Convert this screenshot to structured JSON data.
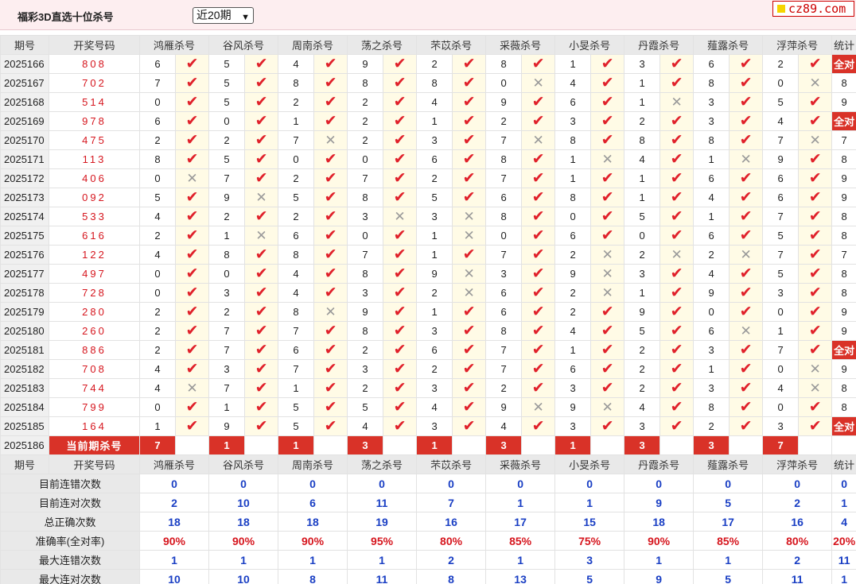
{
  "app": {
    "title": "福彩3D直选十位杀号",
    "period_select": "近20期",
    "logo_text": "cz89.com"
  },
  "headers": {
    "period": "期号",
    "draw": "开奖号码",
    "experts": [
      "鸿雁杀号",
      "谷风杀号",
      "周南杀号",
      "荡之杀号",
      "芣苡杀号",
      "采薇杀号",
      "小旻杀号",
      "丹霞杀号",
      "薤露杀号",
      "浮萍杀号"
    ],
    "stat": "统计"
  },
  "rows": [
    {
      "period": "2025166",
      "draw": "808",
      "kills": [
        6,
        5,
        4,
        9,
        2,
        8,
        1,
        3,
        6,
        2
      ],
      "hits": [
        1,
        1,
        1,
        1,
        1,
        1,
        1,
        1,
        1,
        1
      ],
      "stat": "全对"
    },
    {
      "period": "2025167",
      "draw": "702",
      "kills": [
        7,
        5,
        8,
        8,
        8,
        0,
        4,
        1,
        8,
        0
      ],
      "hits": [
        1,
        1,
        1,
        1,
        1,
        0,
        1,
        1,
        1,
        0
      ],
      "stat": "8"
    },
    {
      "period": "2025168",
      "draw": "514",
      "kills": [
        0,
        5,
        2,
        2,
        4,
        9,
        6,
        1,
        3,
        5
      ],
      "hits": [
        1,
        1,
        1,
        1,
        1,
        1,
        1,
        0,
        1,
        1
      ],
      "stat": "9"
    },
    {
      "period": "2025169",
      "draw": "978",
      "kills": [
        6,
        0,
        1,
        2,
        1,
        2,
        3,
        2,
        3,
        4
      ],
      "hits": [
        1,
        1,
        1,
        1,
        1,
        1,
        1,
        1,
        1,
        1
      ],
      "stat": "全对"
    },
    {
      "period": "2025170",
      "draw": "475",
      "kills": [
        2,
        2,
        7,
        2,
        3,
        7,
        8,
        8,
        8,
        7
      ],
      "hits": [
        1,
        1,
        0,
        1,
        1,
        0,
        1,
        1,
        1,
        0
      ],
      "stat": "7"
    },
    {
      "period": "2025171",
      "draw": "113",
      "kills": [
        8,
        5,
        0,
        0,
        6,
        8,
        1,
        4,
        1,
        9
      ],
      "hits": [
        1,
        1,
        1,
        1,
        1,
        1,
        0,
        1,
        0,
        1
      ],
      "stat": "8"
    },
    {
      "period": "2025172",
      "draw": "406",
      "kills": [
        0,
        7,
        2,
        7,
        2,
        7,
        1,
        1,
        6,
        6
      ],
      "hits": [
        0,
        1,
        1,
        1,
        1,
        1,
        1,
        1,
        1,
        1
      ],
      "stat": "9"
    },
    {
      "period": "2025173",
      "draw": "092",
      "kills": [
        5,
        9,
        5,
        8,
        5,
        6,
        8,
        1,
        4,
        6
      ],
      "hits": [
        1,
        0,
        1,
        1,
        1,
        1,
        1,
        1,
        1,
        1
      ],
      "stat": "9"
    },
    {
      "period": "2025174",
      "draw": "533",
      "kills": [
        4,
        2,
        2,
        3,
        3,
        8,
        0,
        5,
        1,
        7
      ],
      "hits": [
        1,
        1,
        1,
        0,
        0,
        1,
        1,
        1,
        1,
        1
      ],
      "stat": "8"
    },
    {
      "period": "2025175",
      "draw": "616",
      "kills": [
        2,
        1,
        6,
        0,
        1,
        0,
        6,
        0,
        6,
        5
      ],
      "hits": [
        1,
        0,
        1,
        1,
        0,
        1,
        1,
        1,
        1,
        1
      ],
      "stat": "8"
    },
    {
      "period": "2025176",
      "draw": "122",
      "kills": [
        4,
        8,
        8,
        7,
        1,
        7,
        2,
        2,
        2,
        7
      ],
      "hits": [
        1,
        1,
        1,
        1,
        1,
        1,
        0,
        0,
        0,
        1
      ],
      "stat": "7"
    },
    {
      "period": "2025177",
      "draw": "497",
      "kills": [
        0,
        0,
        4,
        8,
        9,
        3,
        9,
        3,
        4,
        5
      ],
      "hits": [
        1,
        1,
        1,
        1,
        0,
        1,
        0,
        1,
        1,
        1
      ],
      "stat": "8"
    },
    {
      "period": "2025178",
      "draw": "728",
      "kills": [
        0,
        3,
        4,
        3,
        2,
        6,
        2,
        1,
        9,
        3
      ],
      "hits": [
        1,
        1,
        1,
        1,
        0,
        1,
        0,
        1,
        1,
        1
      ],
      "stat": "8"
    },
    {
      "period": "2025179",
      "draw": "280",
      "kills": [
        2,
        2,
        8,
        9,
        1,
        6,
        2,
        9,
        0,
        0
      ],
      "hits": [
        1,
        1,
        0,
        1,
        1,
        1,
        1,
        1,
        1,
        1
      ],
      "stat": "9"
    },
    {
      "period": "2025180",
      "draw": "260",
      "kills": [
        2,
        7,
        7,
        8,
        3,
        8,
        4,
        5,
        6,
        1
      ],
      "hits": [
        1,
        1,
        1,
        1,
        1,
        1,
        1,
        1,
        0,
        1
      ],
      "stat": "9"
    },
    {
      "period": "2025181",
      "draw": "886",
      "kills": [
        2,
        7,
        6,
        2,
        6,
        7,
        1,
        2,
        3,
        7
      ],
      "hits": [
        1,
        1,
        1,
        1,
        1,
        1,
        1,
        1,
        1,
        1
      ],
      "stat": "全对"
    },
    {
      "period": "2025182",
      "draw": "708",
      "kills": [
        4,
        3,
        7,
        3,
        2,
        7,
        6,
        2,
        1,
        0
      ],
      "hits": [
        1,
        1,
        1,
        1,
        1,
        1,
        1,
        1,
        1,
        0
      ],
      "stat": "9"
    },
    {
      "period": "2025183",
      "draw": "744",
      "kills": [
        4,
        7,
        1,
        2,
        3,
        2,
        3,
        2,
        3,
        4
      ],
      "hits": [
        0,
        1,
        1,
        1,
        1,
        1,
        1,
        1,
        1,
        0
      ],
      "stat": "8"
    },
    {
      "period": "2025184",
      "draw": "799",
      "kills": [
        0,
        1,
        5,
        5,
        4,
        9,
        9,
        4,
        8,
        0
      ],
      "hits": [
        1,
        1,
        1,
        1,
        1,
        0,
        0,
        1,
        1,
        1
      ],
      "stat": "8"
    },
    {
      "period": "2025185",
      "draw": "164",
      "kills": [
        1,
        9,
        5,
        4,
        3,
        4,
        3,
        3,
        2,
        3
      ],
      "hits": [
        1,
        1,
        1,
        1,
        1,
        1,
        1,
        1,
        1,
        1
      ],
      "stat": "全对"
    }
  ],
  "current": {
    "period": "2025186",
    "label": "当前期杀号",
    "kills": [
      7,
      1,
      1,
      3,
      1,
      3,
      1,
      3,
      3,
      7
    ]
  },
  "summary": [
    {
      "label": "目前连错次数",
      "values": [
        "0",
        "0",
        "0",
        "0",
        "0",
        "0",
        "0",
        "0",
        "0",
        "0"
      ],
      "stat": "0"
    },
    {
      "label": "目前连对次数",
      "values": [
        "2",
        "10",
        "6",
        "11",
        "7",
        "1",
        "1",
        "9",
        "5",
        "2"
      ],
      "stat": "1"
    },
    {
      "label": "总正确次数",
      "values": [
        "18",
        "18",
        "18",
        "19",
        "16",
        "17",
        "15",
        "18",
        "17",
        "16"
      ],
      "stat": "4"
    },
    {
      "label": "准确率(全对率)",
      "values": [
        "90%",
        "90%",
        "90%",
        "95%",
        "80%",
        "85%",
        "75%",
        "90%",
        "85%",
        "80%"
      ],
      "stat": "20%",
      "is_rate": true
    },
    {
      "label": "最大连错次数",
      "values": [
        "1",
        "1",
        "1",
        "1",
        "2",
        "1",
        "3",
        "1",
        "1",
        "2"
      ],
      "stat": "11"
    },
    {
      "label": "最大连对次数",
      "values": [
        "10",
        "10",
        "8",
        "11",
        "8",
        "13",
        "5",
        "9",
        "5",
        "11"
      ],
      "stat": "1"
    }
  ],
  "icons": {
    "hit": "check-icon",
    "miss": "cross-icon"
  },
  "colors": {
    "accent": "#d93228",
    "number": "#d6161e",
    "summary_value": "#1a3fc4",
    "highlight_cell": "#fffbe6"
  }
}
